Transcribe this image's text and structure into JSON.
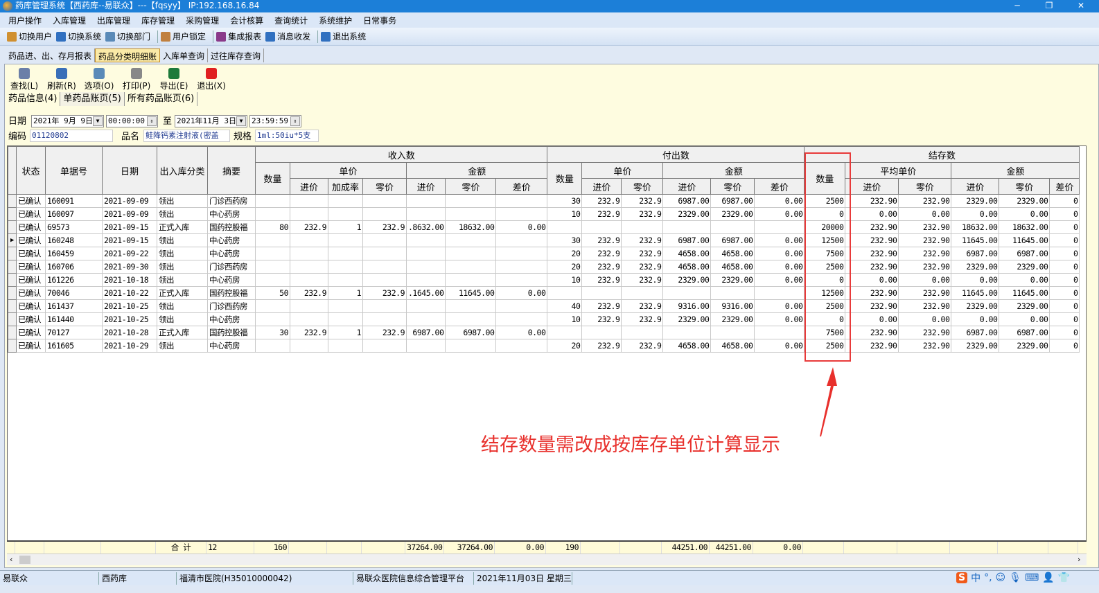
{
  "window": {
    "title": "药库管理系统【西药库--易联众】---【fqsyy】 IP:192.168.16.84"
  },
  "menu": [
    "用户操作",
    "入库管理",
    "出库管理",
    "库存管理",
    "采购管理",
    "会计核算",
    "查询统计",
    "系统维护",
    "日常事务"
  ],
  "toolbar": [
    "切换用户",
    "切换系统",
    "切换部门",
    "用户锁定",
    "集成报表",
    "消息收发",
    "退出系统"
  ],
  "top_tabs": [
    {
      "label": "药品进、出、存月报表",
      "active": false
    },
    {
      "label": "药品分类明细账",
      "active": true
    },
    {
      "label": "入库单查询",
      "active": false
    },
    {
      "label": "过往库存查询",
      "active": false
    }
  ],
  "actions": [
    {
      "label": "查找(L)",
      "icon": "search-icon",
      "color": "#6b7fa8"
    },
    {
      "label": "刷新(R)",
      "icon": "refresh-icon",
      "color": "#3a6fb8"
    },
    {
      "label": "选项(O)",
      "icon": "options-icon",
      "color": "#5a8ab8"
    },
    {
      "label": "打印(P)",
      "icon": "print-icon",
      "color": "#888888"
    },
    {
      "label": "导出(E)",
      "icon": "excel-export-icon",
      "color": "#1e7a3a"
    },
    {
      "label": "退出(X)",
      "icon": "power-icon",
      "color": "#e02020"
    }
  ],
  "sub_tabs": [
    {
      "label": "药品信息(4)",
      "active": false
    },
    {
      "label": "单药品账页(5)",
      "active": true
    },
    {
      "label": "所有药品账页(6)",
      "active": false
    }
  ],
  "filter": {
    "date_label": "日期",
    "date_from": "2021年 9月 9日",
    "time_from": "00:00:00",
    "to_label": "至",
    "date_to": "2021年11月 3日",
    "time_to": "23:59:59",
    "code_label": "编码",
    "code": "01120802",
    "name_label": "品名",
    "name": "鲑降钙素注射液(密盖",
    "spec_label": "规格",
    "spec": "1ml:50iu*5支"
  },
  "grid": {
    "groups": {
      "in": "收入数",
      "out": "付出数",
      "balance": "结存数",
      "unit_price": "单价",
      "amount": "金额",
      "avg_price": "平均单价"
    },
    "fixed_headers": [
      "状态",
      "单据号",
      "日期",
      "出入库分类",
      "摘要"
    ],
    "qty": "数量",
    "sub": {
      "purchase": "进价",
      "markup": "加成率",
      "retail": "零价",
      "diff": "差价"
    },
    "rows": [
      [
        "已确认",
        "160091",
        "2021-09-09",
        "领出",
        "门诊西药房",
        "",
        "",
        "",
        "",
        "",
        "",
        "",
        "30",
        "232.9",
        "232.9",
        "6987.00",
        "6987.00",
        "0.00",
        "2500",
        "232.90",
        "232.90",
        "2329.00",
        "2329.00",
        "0"
      ],
      [
        "已确认",
        "160097",
        "2021-09-09",
        "领出",
        "中心药房",
        "",
        "",
        "",
        "",
        "",
        "",
        "",
        "10",
        "232.9",
        "232.9",
        "2329.00",
        "2329.00",
        "0.00",
        "0",
        "0.00",
        "0.00",
        "0.00",
        "0.00",
        "0"
      ],
      [
        "已确认",
        "69573",
        "2021-09-15",
        "正式入库",
        "国药控股福",
        "80",
        "232.9",
        "1",
        "232.9",
        ".8632.00",
        "18632.00",
        "0.00",
        "",
        "",
        "",
        "",
        "",
        "",
        "20000",
        "232.90",
        "232.90",
        "18632.00",
        "18632.00",
        "0"
      ],
      [
        "已确认",
        "160248",
        "2021-09-15",
        "领出",
        "中心药房",
        "",
        "",
        "",
        "",
        "",
        "",
        "",
        "30",
        "232.9",
        "232.9",
        "6987.00",
        "6987.00",
        "0.00",
        "12500",
        "232.90",
        "232.90",
        "11645.00",
        "11645.00",
        "0"
      ],
      [
        "已确认",
        "160459",
        "2021-09-22",
        "领出",
        "中心药房",
        "",
        "",
        "",
        "",
        "",
        "",
        "",
        "20",
        "232.9",
        "232.9",
        "4658.00",
        "4658.00",
        "0.00",
        "7500",
        "232.90",
        "232.90",
        "6987.00",
        "6987.00",
        "0"
      ],
      [
        "已确认",
        "160706",
        "2021-09-30",
        "领出",
        "门诊西药房",
        "",
        "",
        "",
        "",
        "",
        "",
        "",
        "20",
        "232.9",
        "232.9",
        "4658.00",
        "4658.00",
        "0.00",
        "2500",
        "232.90",
        "232.90",
        "2329.00",
        "2329.00",
        "0"
      ],
      [
        "已确认",
        "161226",
        "2021-10-18",
        "领出",
        "中心药房",
        "",
        "",
        "",
        "",
        "",
        "",
        "",
        "10",
        "232.9",
        "232.9",
        "2329.00",
        "2329.00",
        "0.00",
        "0",
        "0.00",
        "0.00",
        "0.00",
        "0.00",
        "0"
      ],
      [
        "已确认",
        "70046",
        "2021-10-22",
        "正式入库",
        "国药控股福",
        "50",
        "232.9",
        "1",
        "232.9",
        ".1645.00",
        "11645.00",
        "0.00",
        "",
        "",
        "",
        "",
        "",
        "",
        "12500",
        "232.90",
        "232.90",
        "11645.00",
        "11645.00",
        "0"
      ],
      [
        "已确认",
        "161437",
        "2021-10-25",
        "领出",
        "门诊西药房",
        "",
        "",
        "",
        "",
        "",
        "",
        "",
        "40",
        "232.9",
        "232.9",
        "9316.00",
        "9316.00",
        "0.00",
        "2500",
        "232.90",
        "232.90",
        "2329.00",
        "2329.00",
        "0"
      ],
      [
        "已确认",
        "161440",
        "2021-10-25",
        "领出",
        "中心药房",
        "",
        "",
        "",
        "",
        "",
        "",
        "",
        "10",
        "232.9",
        "232.9",
        "2329.00",
        "2329.00",
        "0.00",
        "0",
        "0.00",
        "0.00",
        "0.00",
        "0.00",
        "0"
      ],
      [
        "已确认",
        "70127",
        "2021-10-28",
        "正式入库",
        "国药控股福",
        "30",
        "232.9",
        "1",
        "232.9",
        "6987.00",
        "6987.00",
        "0.00",
        "",
        "",
        "",
        "",
        "",
        "",
        "7500",
        "232.90",
        "232.90",
        "6987.00",
        "6987.00",
        "0"
      ],
      [
        "已确认",
        "161605",
        "2021-10-29",
        "领出",
        "中心药房",
        "",
        "",
        "",
        "",
        "",
        "",
        "",
        "20",
        "232.9",
        "232.9",
        "4658.00",
        "4658.00",
        "0.00",
        "2500",
        "232.90",
        "232.90",
        "2329.00",
        "2329.00",
        "0"
      ]
    ],
    "current_row": 3,
    "totals": {
      "label": "合 计",
      "count": "12",
      "in_qty": "160",
      "in_amt_purchase": "37264.00",
      "in_amt_retail": "37264.00",
      "in_diff": "0.00",
      "out_qty": "190",
      "out_amt_purchase": "44251.00",
      "out_amt_retail": "44251.00",
      "out_diff": "0.00"
    }
  },
  "annotation": {
    "text": "结存数量需改成按库存单位计算显示",
    "color": "#e8302c"
  },
  "status": [
    "易联众",
    "西药库",
    "福清市医院(H35010000042)",
    "易联众医院信息综合管理平台",
    "2021年11月03日 星期三"
  ]
}
